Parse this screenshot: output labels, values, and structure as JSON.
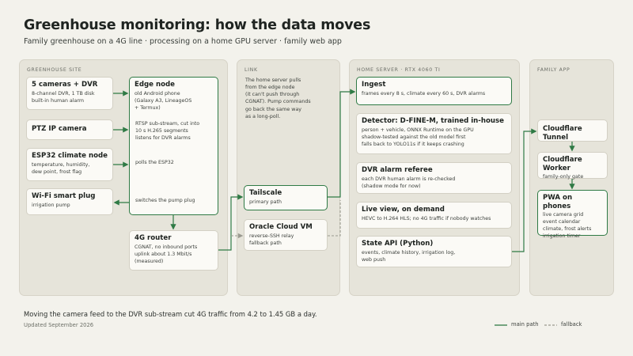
{
  "header": {
    "title": "Greenhouse monitoring: how the data moves",
    "subtitle": "Family greenhouse on a 4G line · processing on a home GPU server · family web app"
  },
  "panels": {
    "site": "GREENHOUSE SITE",
    "link": "LINK",
    "server": "HOME SERVER · RTX 4060 Ti",
    "app": "FAMILY APP"
  },
  "site": {
    "cameras": {
      "title": "5 cameras + DVR",
      "desc": "8-channel DVR, 1 TB disk\nbuilt-in human alarm"
    },
    "ptz": {
      "title": "PTZ IP camera"
    },
    "esp32": {
      "title": "ESP32 climate node",
      "desc": "temperature, humidity,\ndew point, frost flag"
    },
    "plug": {
      "title": "Wi-Fi smart plug",
      "desc": "irrigation pump"
    },
    "edge": {
      "title": "Edge node",
      "desc": "old Android phone\n(Galaxy A3, LineageOS\n+ Termux)"
    },
    "edge_notes": {
      "rtsp": "RTSP sub-stream, cut into\n10 s H.265 segments\nlistens for DVR alarms",
      "esp": "polls the ESP32",
      "pump": "switches the pump plug"
    },
    "router": {
      "title": "4G router",
      "desc": "CGNAT, no inbound ports\nuplink about 1.3 Mbit/s\n(measured)"
    }
  },
  "link": {
    "note": "The home server pulls\nfrom the edge node\n(it can't push through\nCGNAT). Pump commands\ngo back the same way\nas a long-poll.",
    "tailscale": {
      "title": "Tailscale",
      "desc": "primary path"
    },
    "oracle": {
      "title": "Oracle Cloud VM",
      "desc": "reverse-SSH relay\nfallback path"
    }
  },
  "server": {
    "ingest": {
      "title": "Ingest",
      "desc": "frames every 8 s, climate every 60 s, DVR alarms"
    },
    "detector": {
      "title": "Detector: D-FINE-M, trained in-house",
      "desc": "person + vehicle, ONNX Runtime on the GPU\nshadow-tested against the old model first\nfalls back to YOLO11s if it keeps crashing"
    },
    "referee": {
      "title": "DVR alarm referee",
      "desc": "each DVR human alarm is re-checked\n(shadow mode for now)"
    },
    "liveview": {
      "title": "Live view, on demand",
      "desc": "HEVC to H.264 HLS; no 4G traffic if nobody watches"
    },
    "api": {
      "title": "State API (Python)",
      "desc": "events, climate history, irrigation log,\nweb push"
    }
  },
  "app": {
    "tunnel": {
      "title": "Cloudflare Tunnel"
    },
    "worker": {
      "title": "Cloudflare Worker",
      "desc": "family-only gate"
    },
    "pwa": {
      "title": "PWA on phones",
      "desc": "live camera grid\nevent calendar\nclimate, frost alerts\nirrigation timer"
    }
  },
  "footer": {
    "note": "Moving the camera feed to the DVR sub-stream cut 4G traffic from 4.2 to 1.45 GB a day.",
    "date": "Updated September 2026"
  },
  "legend": {
    "main": "main path",
    "fallback": "fallback"
  },
  "colors": {
    "main": "#2f7a45",
    "fallback": "#9a9a90",
    "panel": "#e6e4da",
    "node": "#fbfaf6"
  }
}
